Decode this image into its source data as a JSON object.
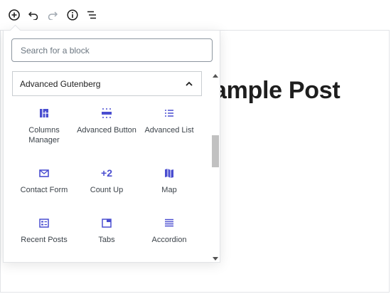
{
  "editor": {
    "post_title": "ample Post"
  },
  "toolbar": {
    "buttons": [
      {
        "name": "add-block",
        "icon": "plus-circle-icon"
      },
      {
        "name": "undo",
        "icon": "undo-icon"
      },
      {
        "name": "redo",
        "icon": "redo-icon"
      },
      {
        "name": "info",
        "icon": "info-icon"
      },
      {
        "name": "outline",
        "icon": "list-view-icon"
      }
    ]
  },
  "inserter": {
    "search": {
      "placeholder": "Search for a block",
      "value": ""
    },
    "panel": {
      "title": "Advanced Gutenberg",
      "expanded": true
    },
    "blocks": [
      {
        "label": "Columns Manager",
        "icon": "columns-icon"
      },
      {
        "label": "Advanced Button",
        "icon": "button-icon"
      },
      {
        "label": "Advanced List",
        "icon": "list-icon"
      },
      {
        "label": "Contact Form",
        "icon": "envelope-icon"
      },
      {
        "label": "Count Up",
        "icon": "plus-two-icon",
        "glyph": "+2"
      },
      {
        "label": "Map",
        "icon": "map-icon"
      },
      {
        "label": "Recent Posts",
        "icon": "recent-posts-icon"
      },
      {
        "label": "Tabs",
        "icon": "tabs-icon"
      },
      {
        "label": "Accordion",
        "icon": "accordion-icon"
      }
    ]
  },
  "colors": {
    "accent": "#4a4ed0",
    "border": "#e2e4e7",
    "text": "#1e1e1e"
  }
}
